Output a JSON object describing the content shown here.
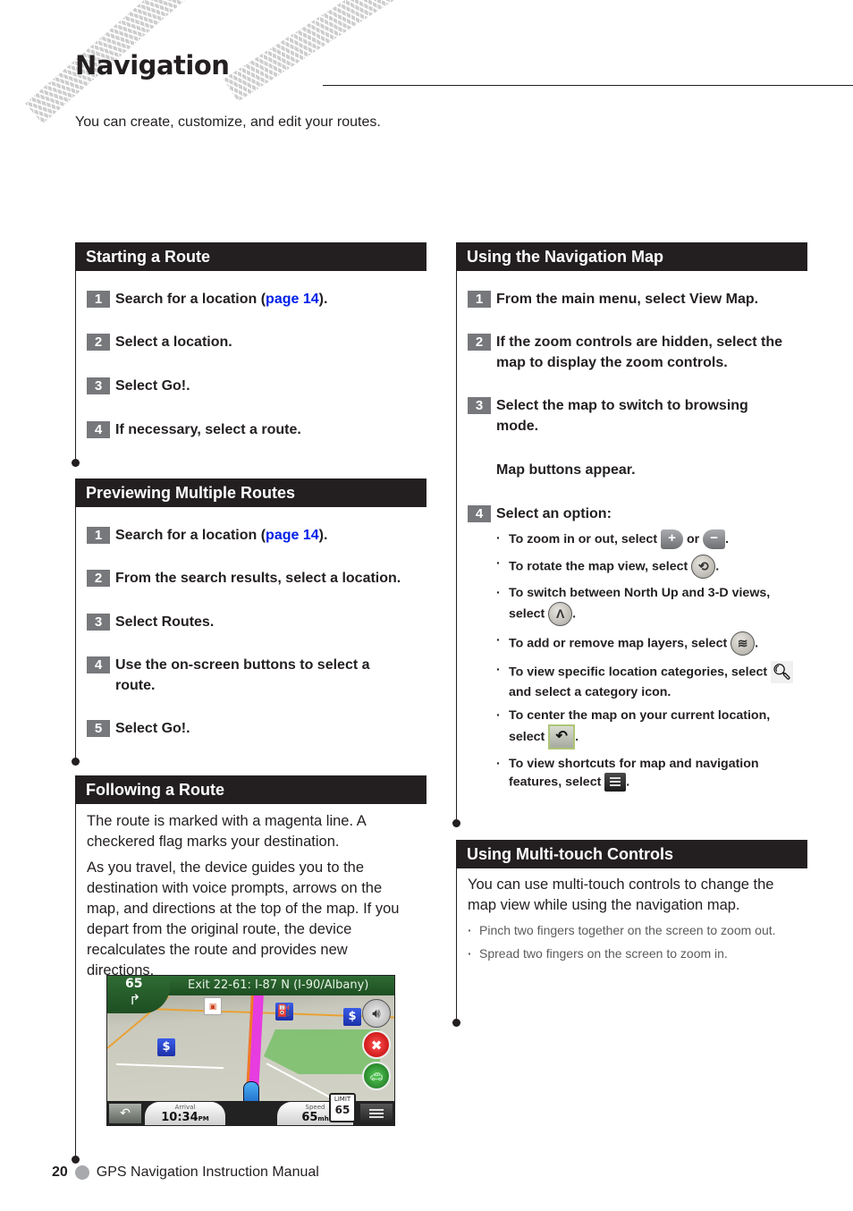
{
  "page": {
    "title": "Navigation",
    "intro": "You can create, customize, and edit your routes."
  },
  "sections": {
    "starting": {
      "heading": "Starting a Route",
      "steps": [
        {
          "num": "1",
          "pre": "Search for a location (",
          "link": "page 14",
          "post": ")."
        },
        {
          "num": "2",
          "text": "Select a location."
        },
        {
          "num": "3",
          "text": "Select Go!."
        },
        {
          "num": "4",
          "text": "If necessary, select a route."
        }
      ]
    },
    "previewing": {
      "heading": "Previewing Multiple Routes",
      "steps": [
        {
          "num": "1",
          "pre": "Search for a location (",
          "link": "page 14",
          "post": ")."
        },
        {
          "num": "2",
          "text": "From the search results, select a location."
        },
        {
          "num": "3",
          "text": "Select Routes."
        },
        {
          "num": "4",
          "text": "Use the on-screen buttons to select a route."
        },
        {
          "num": "5",
          "text": "Select Go!."
        }
      ]
    },
    "following": {
      "heading": "Following a Route",
      "paragraphs": [
        "The route is marked with a magenta line. A checkered flag marks your destination.",
        "As you travel, the device guides you to the destination with voice prompts, arrows on the map, and directions at the top of the map. If you depart from the original route, the device recalculates the route and provides new directions."
      ]
    },
    "nav_map": {
      "heading": "Using the Navigation Map",
      "steps": [
        {
          "num": "1",
          "text": "From the main menu, select View Map."
        },
        {
          "num": "2",
          "text": "If the zoom controls are hidden, select the map to display the zoom controls."
        },
        {
          "num": "3",
          "text": "Select the map to switch to browsing mode.",
          "note": "Map buttons appear."
        },
        {
          "num": "4",
          "text": "Select an option:"
        }
      ],
      "options": [
        {
          "pre": "To zoom in or out, select ",
          "mid": " or ",
          "post": "."
        },
        {
          "pre": "To rotate the map view, select ",
          "post": "."
        },
        {
          "pre": "To switch between North Up and 3-D views, select ",
          "post": "."
        },
        {
          "pre": "To add or remove map layers, select ",
          "post": "."
        },
        {
          "pre": "To view specific location categories, select ",
          "post": " and select a category icon."
        },
        {
          "pre": "To center the map on your current location, select ",
          "post": "."
        },
        {
          "pre": "To view shortcuts for map and navigation features, select ",
          "post": "."
        }
      ],
      "icons": {
        "plus": "+",
        "minus": "−",
        "rotate": "⟲",
        "north": "Λ",
        "layers": "≋",
        "search": "🔍︎",
        "back": "↶"
      }
    },
    "multitouch": {
      "heading": "Using Multi-touch Controls",
      "intro": "You can use multi-touch controls to change the map view while using the navigation map.",
      "bullets": [
        "Pinch two fingers together on the screen to zoom out.",
        "Spread two fingers on the screen to zoom in."
      ]
    }
  },
  "device": {
    "instruction": "Exit 22-61: I-87 N (I-90/Albany)",
    "turn_speed": "65",
    "turn_arrow": "↱",
    "arrival_label": "Arrival",
    "arrival_value": "10:34",
    "arrival_suffix": "PM",
    "speed_label": "Speed",
    "speed_value": "65",
    "speed_unit": "mh",
    "limit_label": "LIMIT",
    "limit_value": "65",
    "pin_dollar": "$",
    "pin_fuel": "⛽",
    "pin_food": "▣",
    "vol_icon": "🔊︎",
    "stop_icon": "✖",
    "traffic_icon": "🚗︎",
    "back_icon": "↶"
  },
  "footer": {
    "page_number": "20",
    "manual_title": "GPS Navigation Instruction Manual"
  },
  "colors": {
    "heading_bg": "#231f20",
    "step_badge": "#77787b",
    "link": "#0020e8",
    "route": "#e63ce0"
  }
}
